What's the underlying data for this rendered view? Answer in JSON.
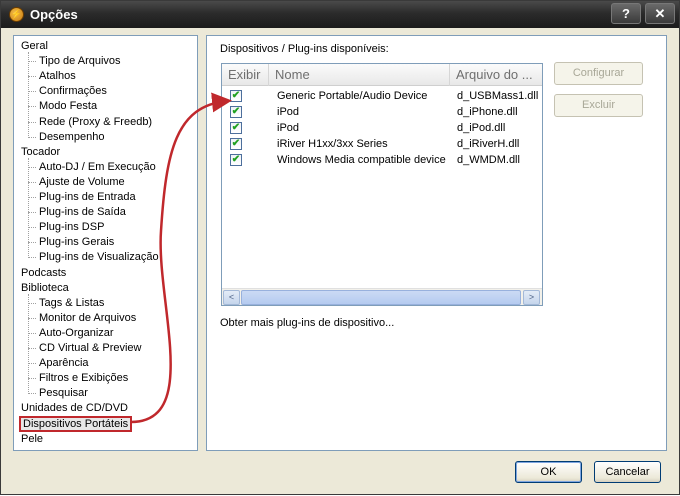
{
  "window": {
    "title": "Opções",
    "app_icon": "winamp-logo-icon",
    "help_glyph": "?",
    "close_glyph": "✕"
  },
  "sidebar": {
    "items": [
      {
        "label": "Geral",
        "level": 0
      },
      {
        "label": "Tipo de Arquivos",
        "level": 1
      },
      {
        "label": "Atalhos",
        "level": 1
      },
      {
        "label": "Confirmações",
        "level": 1
      },
      {
        "label": "Modo Festa",
        "level": 1
      },
      {
        "label": "Rede (Proxy & Freedb)",
        "level": 1
      },
      {
        "label": "Desempenho",
        "level": 1
      },
      {
        "label": "Tocador",
        "level": 0
      },
      {
        "label": "Auto-DJ / Em Execução",
        "level": 1
      },
      {
        "label": "Ajuste de Volume",
        "level": 1
      },
      {
        "label": "Plug-ins de Entrada",
        "level": 1
      },
      {
        "label": "Plug-ins de Saída",
        "level": 1
      },
      {
        "label": "Plug-ins DSP",
        "level": 1
      },
      {
        "label": "Plug-ins Gerais",
        "level": 1
      },
      {
        "label": "Plug-ins de Visualização",
        "level": 1
      },
      {
        "label": "Podcasts",
        "level": 0
      },
      {
        "label": "Biblioteca",
        "level": 0
      },
      {
        "label": "Tags & Listas",
        "level": 1
      },
      {
        "label": "Monitor de Arquivos",
        "level": 1
      },
      {
        "label": "Auto-Organizar",
        "level": 1
      },
      {
        "label": "CD Virtual & Preview",
        "level": 1
      },
      {
        "label": "Aparência",
        "level": 1
      },
      {
        "label": "Filtros e Exibições",
        "level": 1
      },
      {
        "label": "Pesquisar",
        "level": 1
      },
      {
        "label": "Unidades de CD/DVD",
        "level": 0
      },
      {
        "label": "Dispositivos Portáteis",
        "level": 0,
        "selected": true
      },
      {
        "label": "Pele",
        "level": 0
      }
    ]
  },
  "panel": {
    "section_label": "Dispositivos / Plug-ins disponíveis:",
    "columns": [
      "Exibir",
      "Nome",
      "Arquivo do ..."
    ],
    "rows": [
      {
        "checked": true,
        "name": "Generic Portable/Audio Device",
        "file": "d_USBMass1.dll"
      },
      {
        "checked": true,
        "name": "iPod",
        "file": "d_iPhone.dll"
      },
      {
        "checked": true,
        "name": "iPod",
        "file": "d_iPod.dll"
      },
      {
        "checked": true,
        "name": "iRiver H1xx/3xx Series",
        "file": "d_iRiverH.dll"
      },
      {
        "checked": true,
        "name": "Windows Media compatible device",
        "file": "d_WMDM.dll"
      }
    ],
    "check_glyph": "✔",
    "more_link": "Obter mais plug-ins de dispositivo...",
    "configure_label": "Configurar",
    "remove_label": "Excluir"
  },
  "footer": {
    "ok_label": "OK",
    "cancel_label": "Cancelar"
  },
  "colors": {
    "highlight": "#c0282c",
    "titlebar": "#2b2b2b"
  }
}
